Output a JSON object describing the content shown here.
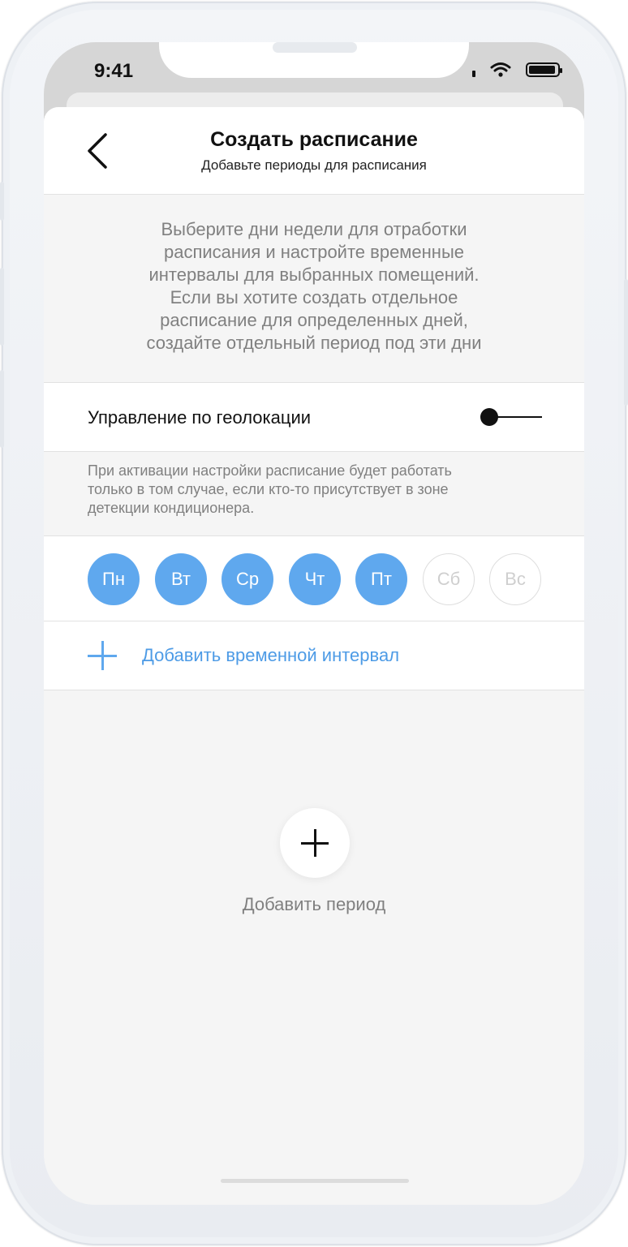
{
  "status_bar": {
    "time": "9:41"
  },
  "header": {
    "title": "Создать расписание",
    "subtitle": "Добавьте периоды для расписания"
  },
  "intro_text": "Выберите дни недели для отработки\nрасписания и настройте временные\nинтервалы для выбранных помещений.\nЕсли вы хотите создать отдельное\nрасписание для определенных дней,\nсоздайте отдельный период под эти дни",
  "geolocation": {
    "label": "Управление по геолокации",
    "note": "При активации настройки расписание будет работать\nтолько в том случае, если кто-то присутствует в зоне\nдетекции кондиционера."
  },
  "days": [
    {
      "label": "Пн"
    },
    {
      "label": "Вт"
    },
    {
      "label": "Ср"
    },
    {
      "label": "Чт"
    },
    {
      "label": "Пт"
    },
    {
      "label": "Сб"
    },
    {
      "label": "Вс"
    }
  ],
  "add_interval_label": "Добавить временной интервал",
  "add_period_label": "Добавить период",
  "colors": {
    "accent": "#5fa8ee",
    "link": "#4d9be6"
  }
}
